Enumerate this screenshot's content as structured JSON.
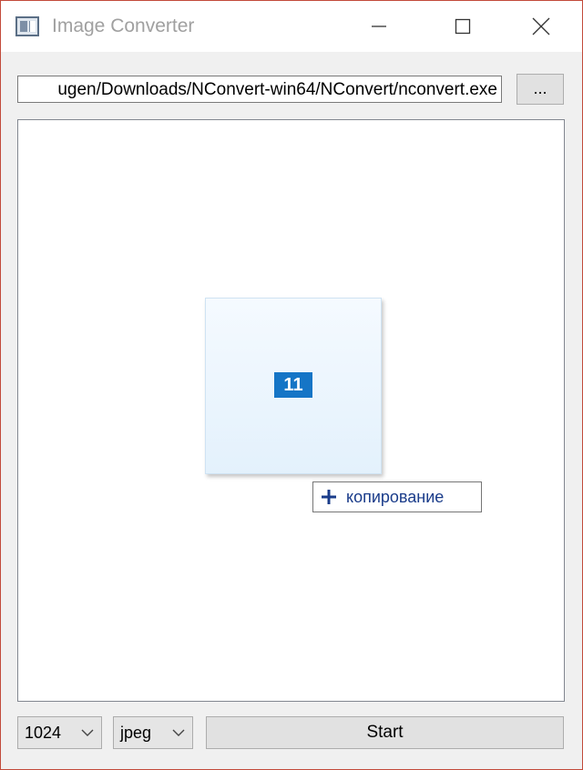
{
  "window": {
    "title": "Image Converter"
  },
  "toolbar": {
    "path_value": "ugen/Downloads/NConvert-win64/NConvert/nconvert.exe",
    "browse_label": "..."
  },
  "drag": {
    "count_badge": "11",
    "tooltip_label": "копирование"
  },
  "bottom": {
    "size_value": "1024",
    "format_value": "jpeg",
    "start_label": "Start"
  },
  "colors": {
    "badge": "#1575c6",
    "tooltip_text": "#1a3c8a",
    "window_border": "#c24a3a"
  },
  "icons": {
    "app": "app-window-icon",
    "minimize": "minimize-icon",
    "maximize": "maximize-icon",
    "close": "close-icon",
    "plus": "plus-icon",
    "chevron": "chevron-down-icon"
  }
}
